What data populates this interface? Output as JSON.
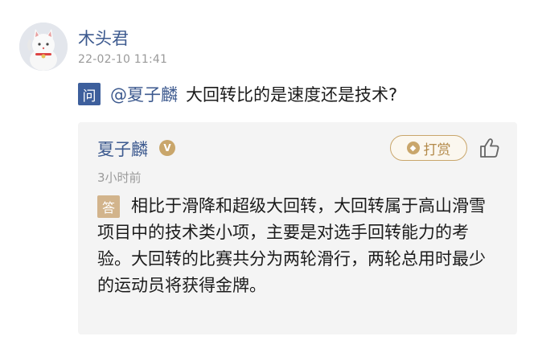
{
  "post": {
    "username": "木头君",
    "timestamp": "22-02-10 11:41"
  },
  "question": {
    "badge": "问",
    "mention": "@夏子麟",
    "text": "大回转比的是速度还是技术?"
  },
  "answer": {
    "answerer": "夏子麟",
    "verified_mark": "V",
    "reward_label": "打赏",
    "time": "3小时前",
    "badge": "答",
    "text": "相比于滑降和超级大回转，大回转属于高山滑雪项目中的技术类小项，主要是对选手回转能力的考验。大回转的比赛共分为两轮滑行，两轮总用时最少的运动员将获得金牌。"
  },
  "icons": {
    "avatar": "lucky-cat-avatar",
    "verified": "verified-badge-icon",
    "reward": "coin-icon",
    "like": "thumbs-up-icon"
  },
  "colors": {
    "link_blue": "#3d5a8f",
    "question_badge": "#3d5f9c",
    "answer_badge": "#d2b48c",
    "gold": "#c9a66b"
  }
}
